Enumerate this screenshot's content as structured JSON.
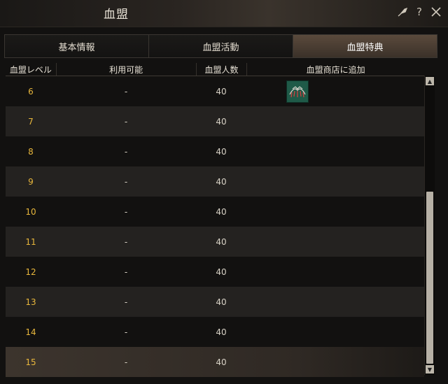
{
  "window": {
    "title": "血盟"
  },
  "tabs": [
    {
      "label": "基本情報",
      "active": false
    },
    {
      "label": "血盟活動",
      "active": false
    },
    {
      "label": "血盟特典",
      "active": true
    }
  ],
  "table": {
    "headers": [
      "血盟レベル",
      "利用可能",
      "血盟人数",
      "血盟商店に追加"
    ],
    "rows": [
      {
        "level": "6",
        "available": "-",
        "members": "40",
        "has_item": true
      },
      {
        "level": "7",
        "available": "-",
        "members": "40",
        "has_item": false
      },
      {
        "level": "8",
        "available": "-",
        "members": "40",
        "has_item": false
      },
      {
        "level": "9",
        "available": "-",
        "members": "40",
        "has_item": false
      },
      {
        "level": "10",
        "available": "-",
        "members": "40",
        "has_item": false
      },
      {
        "level": "11",
        "available": "-",
        "members": "40",
        "has_item": false
      },
      {
        "level": "12",
        "available": "-",
        "members": "40",
        "has_item": false
      },
      {
        "level": "13",
        "available": "-",
        "members": "40",
        "has_item": false
      },
      {
        "level": "14",
        "available": "-",
        "members": "40",
        "has_item": false
      },
      {
        "level": "15",
        "available": "-",
        "members": "40",
        "has_item": false
      }
    ]
  },
  "colors": {
    "level_text": "#e8b73c",
    "active_tab": "#5a4a3c",
    "item_icon_bg": "#1f5a48"
  },
  "icons": [
    "feather-icon",
    "help-icon",
    "close-icon",
    "scroll-up-icon",
    "scroll-down-icon",
    "item-icon"
  ]
}
